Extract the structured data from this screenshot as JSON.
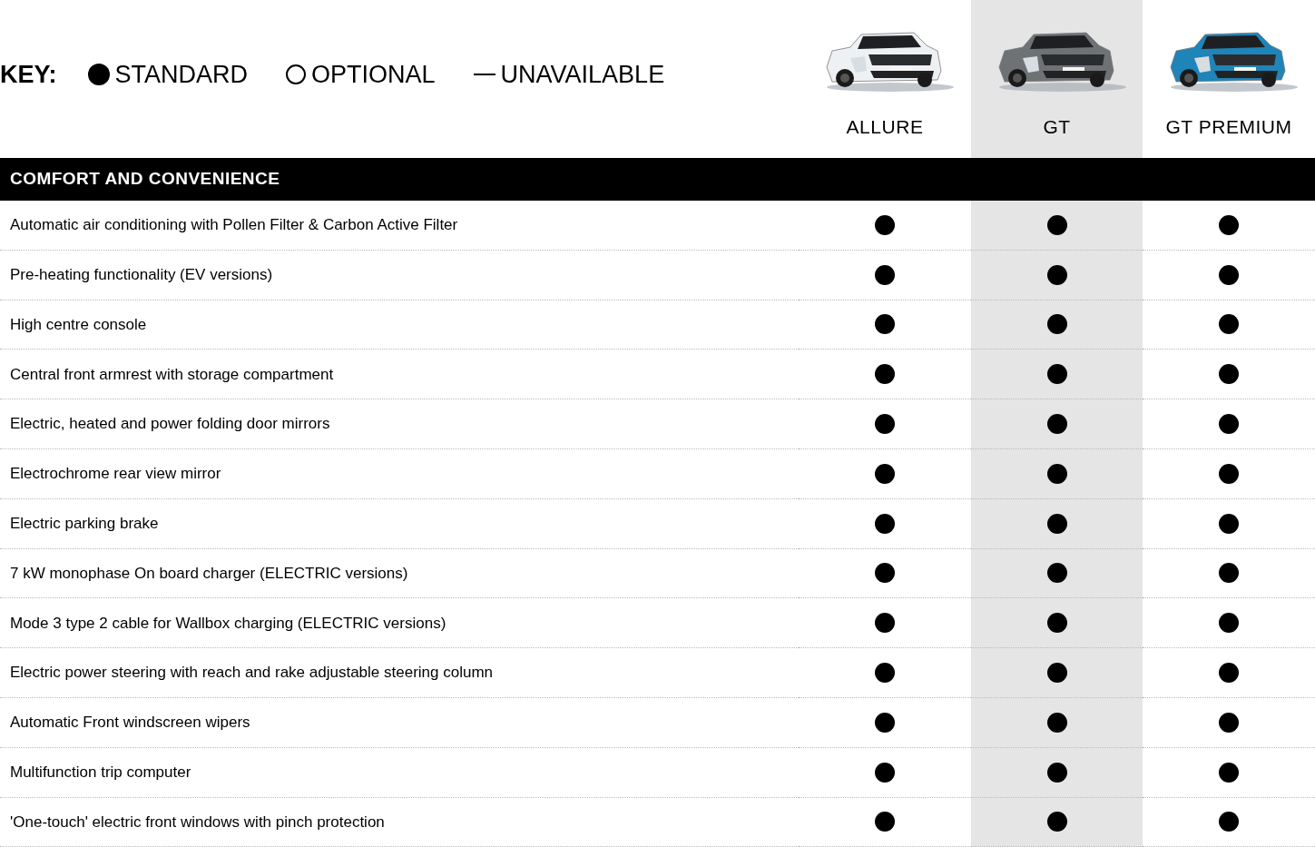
{
  "key": {
    "label": "KEY:",
    "items": [
      {
        "kind": "standard",
        "label": "STANDARD"
      },
      {
        "kind": "optional",
        "label": "OPTIONAL"
      },
      {
        "kind": "unavailable",
        "label": "UNAVAILABLE"
      }
    ]
  },
  "models": [
    {
      "name": "ALLURE",
      "highlighted": false
    },
    {
      "name": "GT",
      "highlighted": true
    },
    {
      "name": "GT PREMIUM",
      "highlighted": false
    }
  ],
  "section": {
    "title": "COMFORT AND CONVENIENCE",
    "rows": [
      {
        "feature": "Automatic air conditioning with Pollen Filter & Carbon Active Filter",
        "values": [
          {
            "kind": "standard"
          },
          {
            "kind": "standard"
          },
          {
            "kind": "standard"
          }
        ]
      },
      {
        "feature": "Pre-heating functionality (EV versions)",
        "values": [
          {
            "kind": "standard"
          },
          {
            "kind": "standard"
          },
          {
            "kind": "standard"
          }
        ]
      },
      {
        "feature": "High centre console",
        "values": [
          {
            "kind": "standard"
          },
          {
            "kind": "standard"
          },
          {
            "kind": "standard"
          }
        ]
      },
      {
        "feature": "Central front armrest with storage compartment",
        "values": [
          {
            "kind": "standard"
          },
          {
            "kind": "standard"
          },
          {
            "kind": "standard"
          }
        ]
      },
      {
        "feature": "Electric, heated and power folding door mirrors",
        "values": [
          {
            "kind": "standard"
          },
          {
            "kind": "standard"
          },
          {
            "kind": "standard"
          }
        ]
      },
      {
        "feature": "Electrochrome rear view mirror",
        "values": [
          {
            "kind": "standard"
          },
          {
            "kind": "standard"
          },
          {
            "kind": "standard"
          }
        ]
      },
      {
        "feature": "Electric parking brake",
        "values": [
          {
            "kind": "standard"
          },
          {
            "kind": "standard"
          },
          {
            "kind": "standard"
          }
        ]
      },
      {
        "feature": "7 kW monophase On board charger (ELECTRIC versions)",
        "values": [
          {
            "kind": "standard"
          },
          {
            "kind": "standard"
          },
          {
            "kind": "standard"
          }
        ]
      },
      {
        "feature": "Mode 3 type 2 cable for Wallbox charging (ELECTRIC versions)",
        "values": [
          {
            "kind": "standard"
          },
          {
            "kind": "standard"
          },
          {
            "kind": "standard"
          }
        ]
      },
      {
        "feature": "Electric power steering with reach and rake adjustable steering column",
        "values": [
          {
            "kind": "standard"
          },
          {
            "kind": "standard"
          },
          {
            "kind": "standard"
          }
        ]
      },
      {
        "feature": "Automatic Front windscreen wipers",
        "values": [
          {
            "kind": "standard"
          },
          {
            "kind": "standard"
          },
          {
            "kind": "standard"
          }
        ]
      },
      {
        "feature": "Multifunction trip computer",
        "values": [
          {
            "kind": "standard"
          },
          {
            "kind": "standard"
          },
          {
            "kind": "standard"
          }
        ]
      },
      {
        "feature": "'One-touch' electric front windows with pinch protection",
        "values": [
          {
            "kind": "standard"
          },
          {
            "kind": "standard"
          },
          {
            "kind": "standard"
          }
        ]
      }
    ]
  }
}
